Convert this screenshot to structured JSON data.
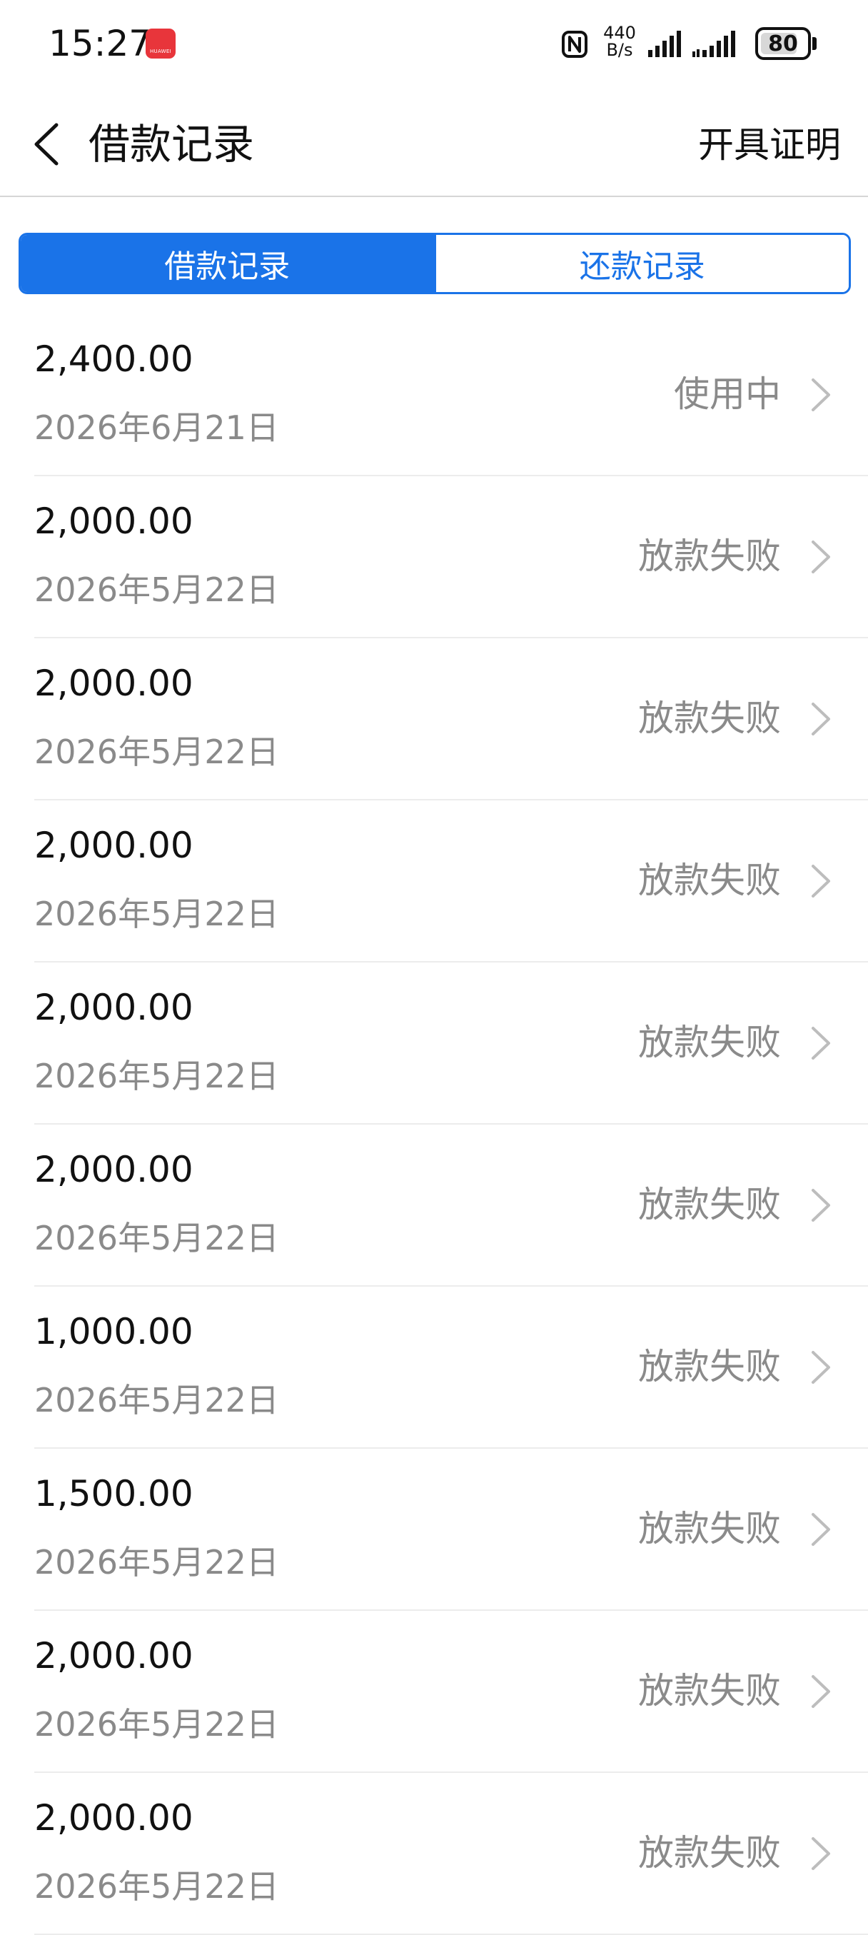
{
  "status_bar": {
    "time": "15:27",
    "app_badge": "HUAWEI",
    "net_speed_value": "440",
    "net_speed_unit": "B/s",
    "battery": "80",
    "battery_level_percent": 80
  },
  "header": {
    "title": "借款记录",
    "certificate_label": "开具证明"
  },
  "tabs": [
    {
      "label": "借款记录",
      "active": true
    },
    {
      "label": "还款记录",
      "active": false
    }
  ],
  "records": [
    {
      "amount": "2,400.00",
      "date": "2026年6月21日",
      "status": "使用中"
    },
    {
      "amount": "2,000.00",
      "date": "2026年5月22日",
      "status": "放款失败"
    },
    {
      "amount": "2,000.00",
      "date": "2026年5月22日",
      "status": "放款失败"
    },
    {
      "amount": "2,000.00",
      "date": "2026年5月22日",
      "status": "放款失败"
    },
    {
      "amount": "2,000.00",
      "date": "2026年5月22日",
      "status": "放款失败"
    },
    {
      "amount": "2,000.00",
      "date": "2026年5月22日",
      "status": "放款失败"
    },
    {
      "amount": "1,000.00",
      "date": "2026年5月22日",
      "status": "放款失败"
    },
    {
      "amount": "1,500.00",
      "date": "2026年5月22日",
      "status": "放款失败"
    },
    {
      "amount": "2,000.00",
      "date": "2026年5月22日",
      "status": "放款失败"
    },
    {
      "amount": "2,000.00",
      "date": "2026年5月22日",
      "status": "放款失败"
    }
  ],
  "colors": {
    "accent": "#1a73e8",
    "secondary_text": "#8a8a8a",
    "badge": "#e8353b"
  }
}
